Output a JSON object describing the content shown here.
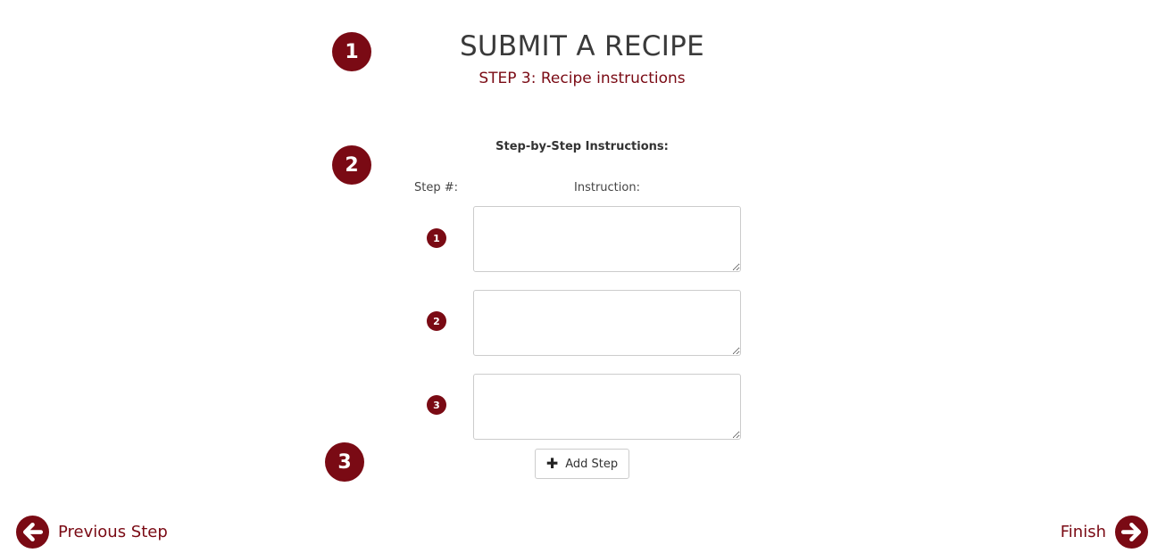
{
  "header": {
    "title": "SUBMIT A RECIPE",
    "subtitle": "STEP 3: Recipe instructions"
  },
  "callouts": [
    "1",
    "2",
    "3"
  ],
  "instructions": {
    "section_label": "Step-by-Step Instructions:",
    "step_header": "Step #:",
    "instruction_header": "Instruction:",
    "steps": [
      {
        "number": "1",
        "value": ""
      },
      {
        "number": "2",
        "value": ""
      },
      {
        "number": "3",
        "value": ""
      }
    ],
    "add_step_label": "Add Step",
    "add_step_icon": "plus-icon"
  },
  "navigation": {
    "previous_label": "Previous Step",
    "previous_icon": "arrow-left-circle-icon",
    "next_label": "Finish",
    "next_icon": "arrow-right-circle-icon"
  },
  "colors": {
    "accent": "#7a0a14",
    "text": "#333333"
  }
}
